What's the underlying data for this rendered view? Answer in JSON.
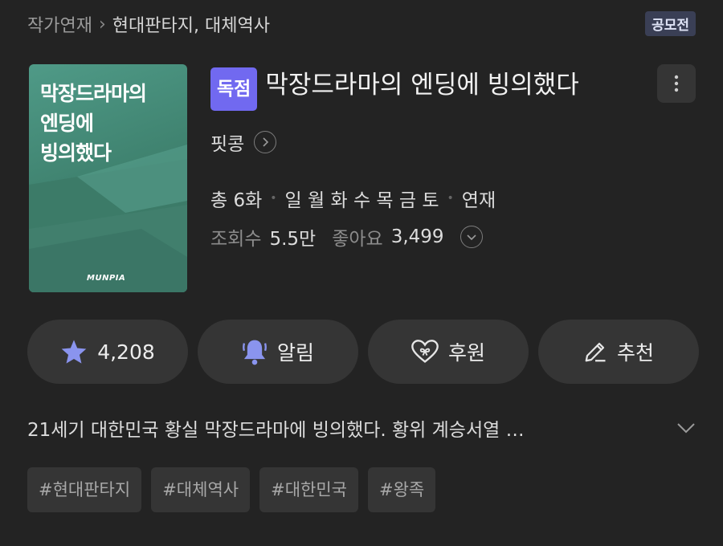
{
  "breadcrumb": {
    "category": "작가연재",
    "separator": "›",
    "genre": "현대판타지, 대체역사"
  },
  "contest_badge": "공모전",
  "cover": {
    "title": "막장드라마의\n엔딩에\n빙의했다",
    "publisher_logo": "MUNPIA"
  },
  "exclusive_badge": "독점",
  "title": "막장드라마의 엔딩에 빙의했다",
  "author": "핏콩",
  "meta": {
    "total_episodes": "총 6화",
    "days": "일 월 화 수 목 금 토",
    "status": "연재"
  },
  "stats": {
    "views_label": "조회수",
    "views": "5.5만",
    "likes_label": "좋아요",
    "likes": "3,499"
  },
  "actions": [
    {
      "label": "4,208",
      "icon": "star-icon"
    },
    {
      "label": "알림",
      "icon": "bell-icon"
    },
    {
      "label": "후원",
      "icon": "heart-gift-icon"
    },
    {
      "label": "추천",
      "icon": "pencil-icon"
    }
  ],
  "synopsis": "21세기 대한민국 황실 막장드라마에 빙의했다.  황위 계승서열 …",
  "tags": [
    "#현대판타지",
    "#대체역사",
    "#대한민국",
    "#왕족"
  ],
  "colors": {
    "background": "#232323",
    "accent": "#7169f0",
    "icon_accent": "#8a94ee"
  }
}
